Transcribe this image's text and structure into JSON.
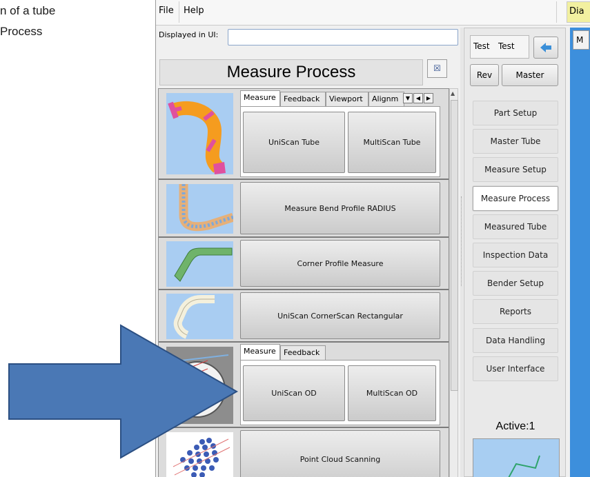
{
  "document": {
    "line1": "n of a tube",
    "line2": "Process"
  },
  "menu": {
    "file": "File",
    "help": "Help",
    "right_fragment": "Dia"
  },
  "displayed_in_ui": {
    "label": "Displayed in UI:",
    "value": ""
  },
  "panel_title": "Measure Process",
  "rows": [
    {
      "tabs": [
        "Measure",
        "Feedback",
        "Viewport",
        "Alignm"
      ],
      "buttons": [
        "UniScan Tube",
        "MultiScan Tube"
      ]
    },
    {
      "button": "Measure Bend Profile RADIUS"
    },
    {
      "button": "Corner Profile Measure"
    },
    {
      "button": "UniScan CornerScan Rectangular"
    },
    {
      "tabs": [
        "Measure",
        "Feedback"
      ],
      "buttons": [
        "UniScan OD",
        "MultiScan OD"
      ]
    },
    {
      "button": "Point Cloud Scanning"
    }
  ],
  "mid": {
    "test_label": "Test",
    "test_button": "Test",
    "rev": "Rev",
    "master": "Master",
    "nav": [
      "Part Setup",
      "Master Tube",
      "Measure Setup",
      "Measure Process",
      "Measured Tube",
      "Inspection Data",
      "Bender Setup",
      "Reports",
      "Data Handling",
      "User Interface"
    ],
    "active_nav": "Measure Process",
    "active_label": "Active:1"
  },
  "right_strip": {
    "top_fragment": "M"
  },
  "colors": {
    "arrow_fill": "#4a78b5",
    "arrow_stroke": "#2b4f82",
    "right_strip": "#3d8fdc"
  }
}
